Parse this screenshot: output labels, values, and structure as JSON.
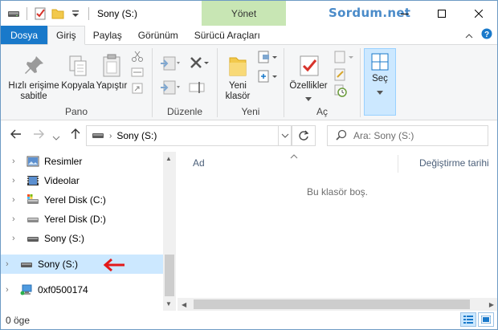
{
  "title_bar": {
    "title": "Sony (S:)",
    "contextual_tab": "Yönet",
    "watermark": "Sordum.net"
  },
  "tabs": [
    {
      "label": "Dosya"
    },
    {
      "label": "Giriş"
    },
    {
      "label": "Paylaş"
    },
    {
      "label": "Görünüm"
    },
    {
      "label": "Sürücü Araçları"
    }
  ],
  "ribbon": {
    "pano": {
      "label": "Pano",
      "pin": "Hızlı erişime sabitle",
      "copy": "Kopyala",
      "paste": "Yapıştır"
    },
    "duzenle": {
      "label": "Düzenle"
    },
    "yeni": {
      "label": "Yeni",
      "new_folder": "Yeni klasör"
    },
    "ac": {
      "label": "Aç",
      "properties": "Özellikler"
    },
    "sec": {
      "select": "Seç"
    }
  },
  "address": {
    "path": "Sony (S:)",
    "search_placeholder": "Ara: Sony (S:)"
  },
  "nav_pane": {
    "items": [
      {
        "label": "Resimler"
      },
      {
        "label": "Videolar"
      },
      {
        "label": "Yerel Disk (C:)"
      },
      {
        "label": "Yerel Disk (D:)"
      },
      {
        "label": "Sony (S:)"
      },
      {
        "label": "Sony (S:)"
      },
      {
        "label": "0xf0500174"
      }
    ]
  },
  "content": {
    "columns": [
      {
        "label": "Ad"
      },
      {
        "label": "Değiştirme tarihi"
      }
    ],
    "empty_message": "Bu klasör boş."
  },
  "status": {
    "item_count": "0 öge"
  },
  "colors": {
    "file_tab": "#1979ca",
    "contextual": "#c8e6b4",
    "selected_row": "#cce8ff",
    "watermark": "#4a8bc9",
    "annotation_arrow": "#e31919"
  }
}
